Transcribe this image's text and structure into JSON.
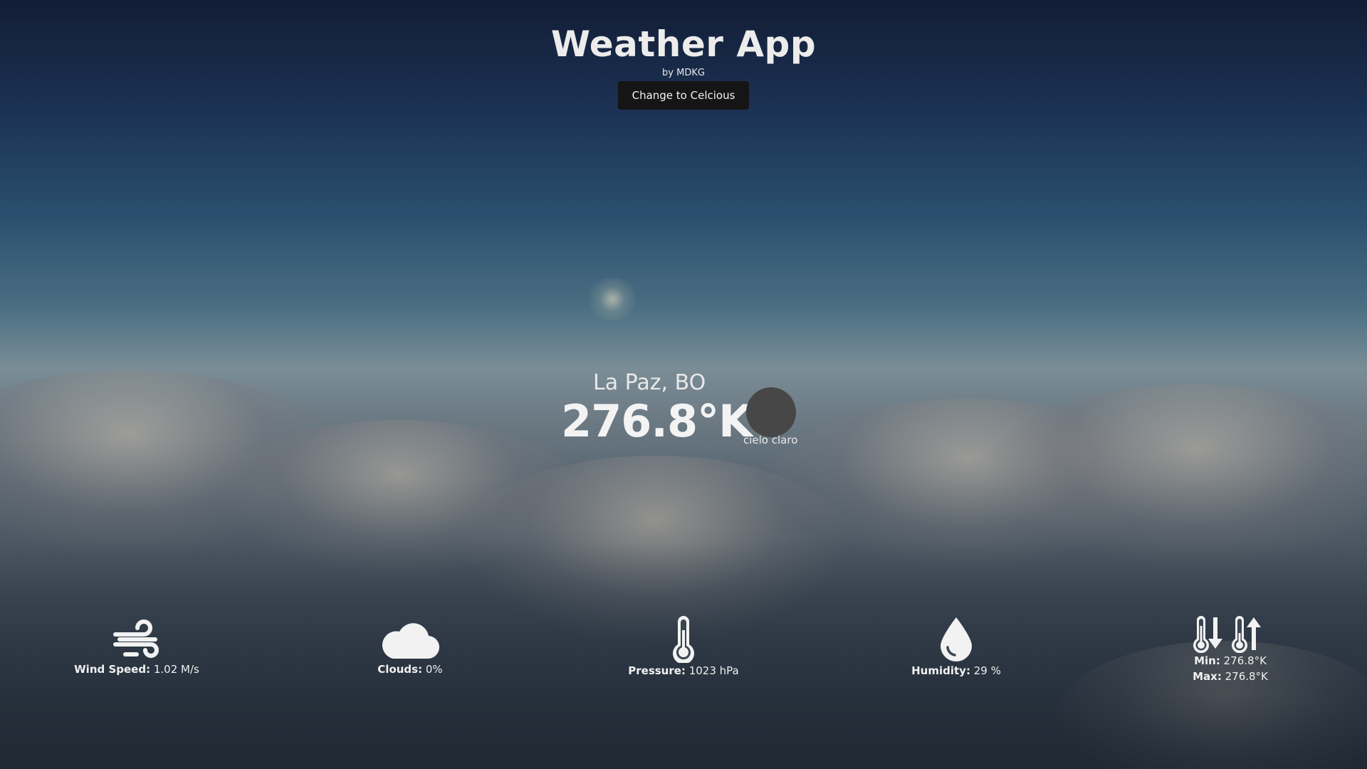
{
  "header": {
    "title": "Weather App",
    "byline": "by MDKG",
    "unit_toggle_label": "Change to Celcious"
  },
  "current": {
    "location": "La Paz, BO",
    "temperature": "276.8°K",
    "description": "cielo claro",
    "icon": "weather-condition-icon"
  },
  "stats": {
    "wind": {
      "label": "Wind Speed:",
      "value": "1.02 M/s",
      "icon": "wind-icon"
    },
    "clouds": {
      "label": "Clouds:",
      "value": "0%",
      "icon": "cloud-icon"
    },
    "pressure": {
      "label": "Pressure:",
      "value": "1023 hPa",
      "icon": "thermometer-icon"
    },
    "humidity": {
      "label": "Humidity:",
      "value": "29 %",
      "icon": "water-drop-icon"
    },
    "minmax": {
      "min_label": "Min:",
      "min_value": "276.8°K",
      "max_label": "Max:",
      "max_value": "276.8°K",
      "icon": "temperature-min-max-icon"
    }
  },
  "colors": {
    "sky_top": "#121d35",
    "sky_horizon": "#7a8d96",
    "button_bg": "#151515",
    "text": "#f2f2f2",
    "icon_placeholder": "#474747"
  }
}
